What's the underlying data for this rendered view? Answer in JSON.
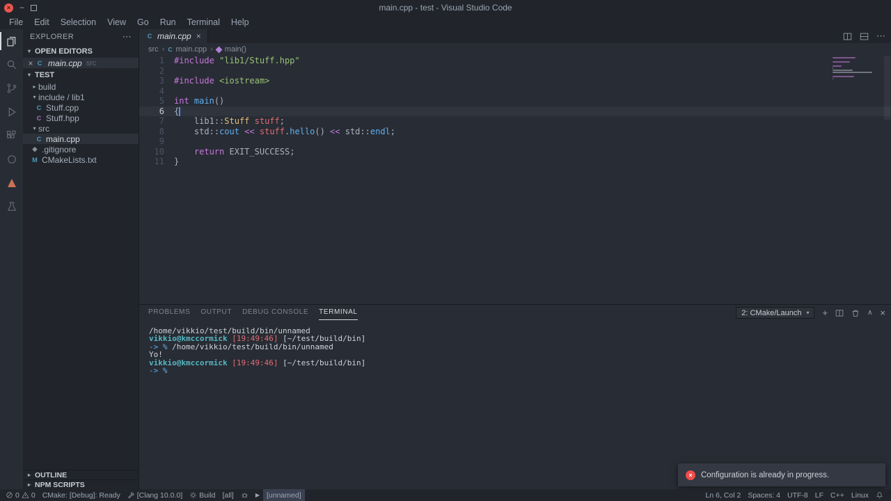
{
  "colors": {
    "keyword": "#c678dd",
    "string": "#98c379",
    "type": "#e5c07b",
    "func": "#61afef",
    "var": "#e06c75",
    "fg": "#abb2bf",
    "out": "#ced3db",
    "user": "#56b6c2",
    "time": "#e06c75",
    "prompt": "#61afef",
    "error_red": "#f14c4c",
    "cpp_icon_blue": "#519aba",
    "hpp_icon_purple": "#a074c4",
    "cmake_icon_orange": "#cb7155"
  },
  "titlebar": {
    "title": "main.cpp - test - Visual Studio Code"
  },
  "menubar": {
    "items": [
      "File",
      "Edit",
      "Selection",
      "View",
      "Go",
      "Run",
      "Terminal",
      "Help"
    ]
  },
  "activity_bar": {
    "items": [
      {
        "name": "explorer",
        "active": true
      },
      {
        "name": "search"
      },
      {
        "name": "source-control"
      },
      {
        "name": "run-debug"
      },
      {
        "name": "extensions"
      },
      {
        "name": "remote-explorer"
      },
      {
        "name": "cmake"
      },
      {
        "name": "test-explorer"
      }
    ]
  },
  "sidebar": {
    "title": "EXPLORER",
    "open_editors_label": "OPEN EDITORS",
    "open_editor": {
      "file": "main.cpp",
      "detail": "src"
    },
    "workspace": "TEST",
    "tree": [
      {
        "label": "build",
        "kind": "folder",
        "expanded": false
      },
      {
        "label": "include / lib1",
        "kind": "folder",
        "expanded": true
      },
      {
        "label": "Stuff.cpp",
        "kind": "cpp",
        "child": true
      },
      {
        "label": "Stuff.hpp",
        "kind": "hpp",
        "child": true
      },
      {
        "label": "src",
        "kind": "folder",
        "expanded": true
      },
      {
        "label": "main.cpp",
        "kind": "cpp",
        "child": true,
        "selected": true
      },
      {
        "label": ".gitignore",
        "kind": "git"
      },
      {
        "label": "CMakeLists.txt",
        "kind": "cmake"
      }
    ],
    "outline_label": "OUTLINE",
    "npm_label": "NPM SCRIPTS"
  },
  "editor": {
    "tab": "main.cpp",
    "breadcrumbs": [
      {
        "label": "src"
      },
      {
        "label": "main.cpp",
        "icon": "cpp"
      },
      {
        "label": "main()",
        "icon": "method"
      }
    ],
    "active_line": 6,
    "lines": [
      {
        "tokens": [
          [
            "#include",
            "keyword"
          ],
          [
            " ",
            "fg"
          ],
          [
            "\"lib1/Stuff.hpp\"",
            "string"
          ]
        ]
      },
      {
        "tokens": []
      },
      {
        "tokens": [
          [
            "#include",
            "keyword"
          ],
          [
            " ",
            "fg"
          ],
          [
            "<iostream>",
            "string"
          ]
        ]
      },
      {
        "tokens": []
      },
      {
        "tokens": [
          [
            "int",
            "keyword"
          ],
          [
            " ",
            "fg"
          ],
          [
            "main",
            "func"
          ],
          [
            "()",
            "fg"
          ]
        ]
      },
      {
        "tokens": [
          [
            "{",
            "fg"
          ]
        ]
      },
      {
        "tokens": [
          [
            "    ",
            "fg"
          ],
          [
            "lib1",
            "fg"
          ],
          [
            "::",
            "fg"
          ],
          [
            "Stuff",
            "type"
          ],
          [
            " ",
            "fg"
          ],
          [
            "stuff",
            "var"
          ],
          [
            ";",
            "fg"
          ]
        ]
      },
      {
        "tokens": [
          [
            "    ",
            "fg"
          ],
          [
            "std",
            "fg"
          ],
          [
            "::",
            "fg"
          ],
          [
            "cout",
            "func"
          ],
          [
            " ",
            "fg"
          ],
          [
            "<<",
            "keyword"
          ],
          [
            " ",
            "fg"
          ],
          [
            "stuff",
            "var"
          ],
          [
            ".",
            "fg"
          ],
          [
            "hello",
            "func"
          ],
          [
            "()",
            "fg"
          ],
          [
            " ",
            "fg"
          ],
          [
            "<<",
            "keyword"
          ],
          [
            " ",
            "fg"
          ],
          [
            "std",
            "fg"
          ],
          [
            "::",
            "fg"
          ],
          [
            "endl",
            "func"
          ],
          [
            ";",
            "fg"
          ]
        ]
      },
      {
        "tokens": []
      },
      {
        "tokens": [
          [
            "    ",
            "fg"
          ],
          [
            "return",
            "keyword"
          ],
          [
            " ",
            "fg"
          ],
          [
            "EXIT_SUCCESS",
            "fg"
          ],
          [
            ";",
            "fg"
          ]
        ]
      },
      {
        "tokens": [
          [
            "}",
            "fg"
          ]
        ]
      }
    ]
  },
  "panel": {
    "tabs": [
      {
        "label": "PROBLEMS"
      },
      {
        "label": "OUTPUT"
      },
      {
        "label": "DEBUG CONSOLE"
      },
      {
        "label": "TERMINAL",
        "active": true
      }
    ],
    "terminal_picker": "2: CMake/Launch",
    "terminal": [
      {
        "tokens": [
          [
            "/home/vikkio/test/build/bin/unnamed",
            "out"
          ]
        ]
      },
      {
        "tokens": [
          [
            "vikkio@kmccormick",
            "user"
          ],
          [
            " ",
            "out"
          ],
          [
            "[19:49:46]",
            "time"
          ],
          [
            " ",
            "out"
          ],
          [
            "[~/test/build/bin]",
            "out"
          ]
        ]
      },
      {
        "tokens": [
          [
            "-> % ",
            "prompt"
          ],
          [
            "/home/vikkio/test/build/bin/unnamed",
            "out"
          ]
        ]
      },
      {
        "tokens": [
          [
            "Yo!",
            "out"
          ]
        ]
      },
      {
        "tokens": [
          [
            "vikkio@kmccormick",
            "user"
          ],
          [
            " ",
            "out"
          ],
          [
            "[19:49:46]",
            "time"
          ],
          [
            " ",
            "out"
          ],
          [
            "[~/test/build/bin]",
            "out"
          ]
        ]
      },
      {
        "tokens": [
          [
            "-> %",
            "prompt"
          ]
        ]
      }
    ]
  },
  "notification": {
    "message": "Configuration is already in progress."
  },
  "status_bar": {
    "errors": "0",
    "warnings": "0",
    "cmake": "CMake: [Debug]: Ready",
    "kit": "[Clang 10.0.0]",
    "build": "Build",
    "target": "[all]",
    "launch_target": "[unnamed]",
    "cursor": "Ln 6, Col 2",
    "indent": "Spaces: 4",
    "encoding": "UTF-8",
    "eol": "LF",
    "language": "C++",
    "os": "Linux"
  }
}
